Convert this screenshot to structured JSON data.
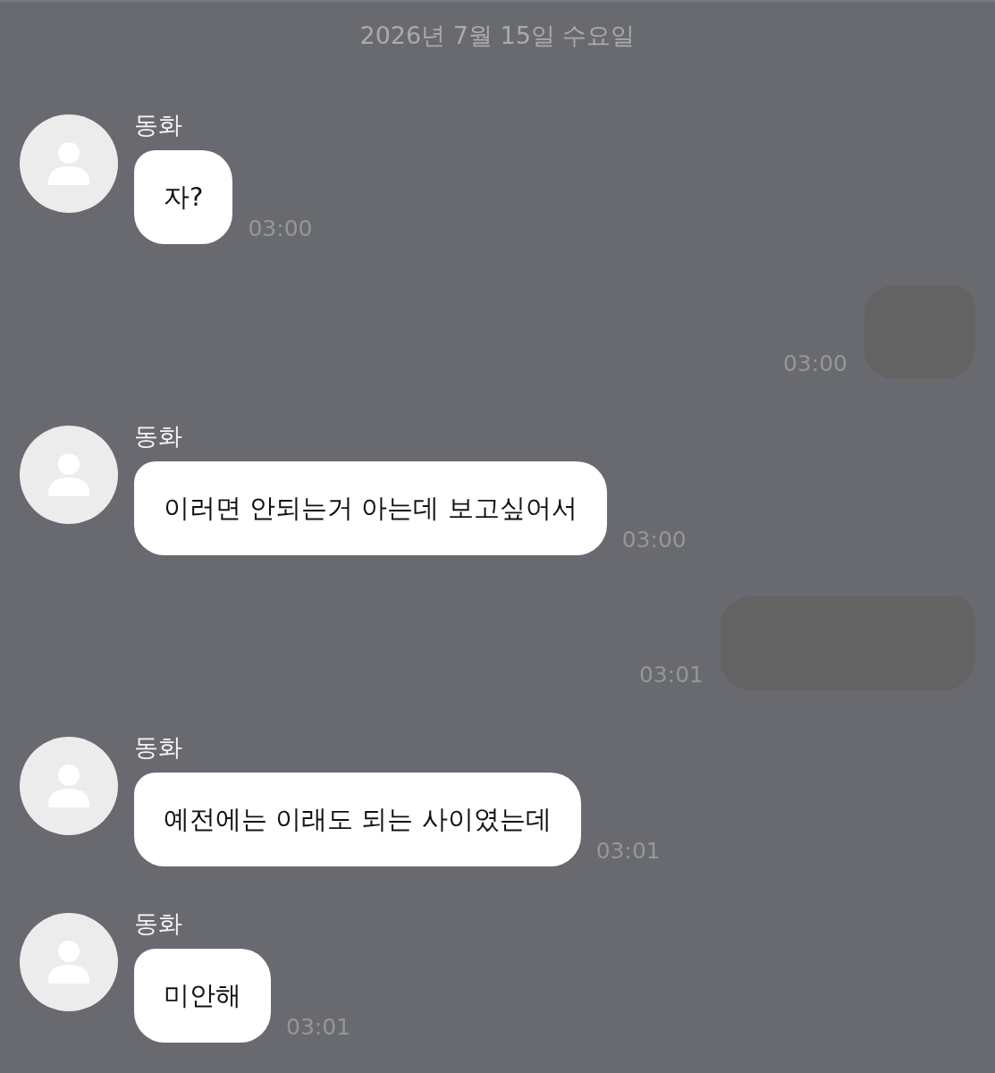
{
  "date_header": "2026년 7월 15일 수요일",
  "messages": [
    {
      "kind": "incoming",
      "sender": "동화",
      "text": "자?",
      "time": "03:00"
    },
    {
      "kind": "outgoing",
      "time": "03:00"
    },
    {
      "kind": "incoming",
      "sender": "동화",
      "text": "이러면 안되는거 아는데 보고싶어서",
      "time": "03:00"
    },
    {
      "kind": "outgoing",
      "time": "03:01"
    },
    {
      "kind": "incoming",
      "sender": "동화",
      "text": "예전에는 이래도 되는 사이였는데",
      "time": "03:01"
    },
    {
      "kind": "incoming",
      "sender": "동화",
      "text": "미안해",
      "time": "03:01"
    }
  ]
}
